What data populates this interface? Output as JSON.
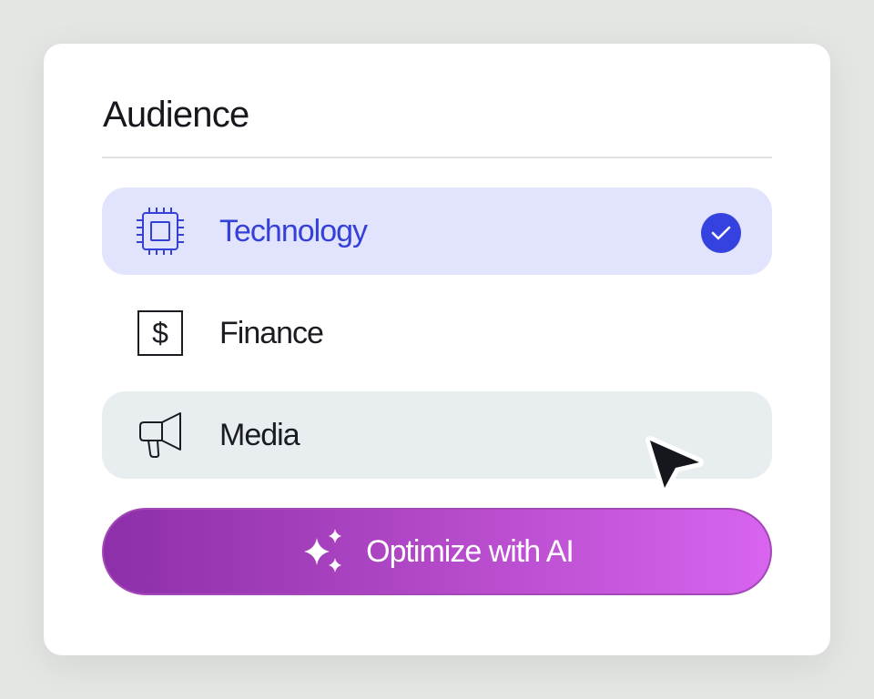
{
  "panel": {
    "title": "Audience"
  },
  "options": [
    {
      "label": "Technology",
      "icon": "cpu-icon",
      "state": "selected"
    },
    {
      "label": "Finance",
      "icon": "dollar-icon",
      "state": "default"
    },
    {
      "label": "Media",
      "icon": "megaphone-icon",
      "state": "hover"
    }
  ],
  "action": {
    "label": "Optimize with AI",
    "icon": "sparkles-icon"
  },
  "colors": {
    "accent": "#3542e0",
    "selected_bg": "#e2e4fd",
    "hover_bg": "#e8eef0",
    "cta_gradient_start": "#8c2fa9",
    "cta_gradient_end": "#d864ef"
  }
}
